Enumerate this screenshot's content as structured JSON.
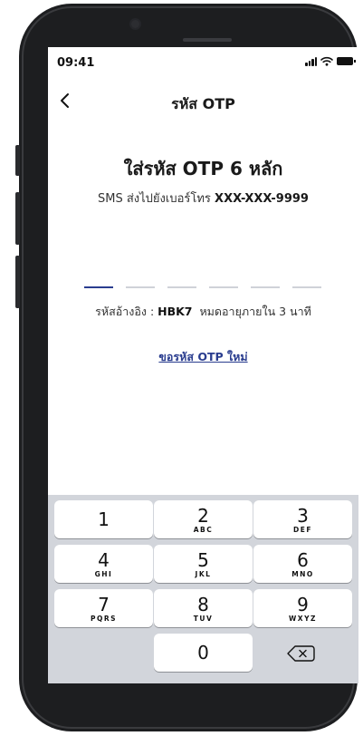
{
  "status_bar": {
    "time": "09:41"
  },
  "nav": {
    "title": "รหัส OTP",
    "back_icon": "chevron-left-icon"
  },
  "headline": "ใส่รหัส OTP 6 หลัก",
  "sms": {
    "prefix": "SMS ส่งไปยังเบอร์โทร ",
    "number": "XXX-XXX-9999"
  },
  "otp": {
    "length": 6,
    "active_index": 0
  },
  "reference": {
    "label": "รหัสอ้างอิง : ",
    "code": "HBK7",
    "expiry": "  หมดอายุภายใน 3 นาที"
  },
  "resend_link": "ขอรหัส OTP ใหม่",
  "keypad": {
    "keys": [
      {
        "digit": "1",
        "letters": ""
      },
      {
        "digit": "2",
        "letters": "ABC"
      },
      {
        "digit": "3",
        "letters": "DEF"
      },
      {
        "digit": "4",
        "letters": "GHI"
      },
      {
        "digit": "5",
        "letters": "JKL"
      },
      {
        "digit": "6",
        "letters": "MNO"
      },
      {
        "digit": "7",
        "letters": "PQRS"
      },
      {
        "digit": "8",
        "letters": "TUV"
      },
      {
        "digit": "9",
        "letters": "WXYZ"
      },
      {
        "digit": "0",
        "letters": ""
      }
    ],
    "delete_icon": "backspace-icon"
  },
  "colors": {
    "accent": "#2a3d8f",
    "keypad_bg": "#d2d5db",
    "frame": "#1d1e20"
  }
}
